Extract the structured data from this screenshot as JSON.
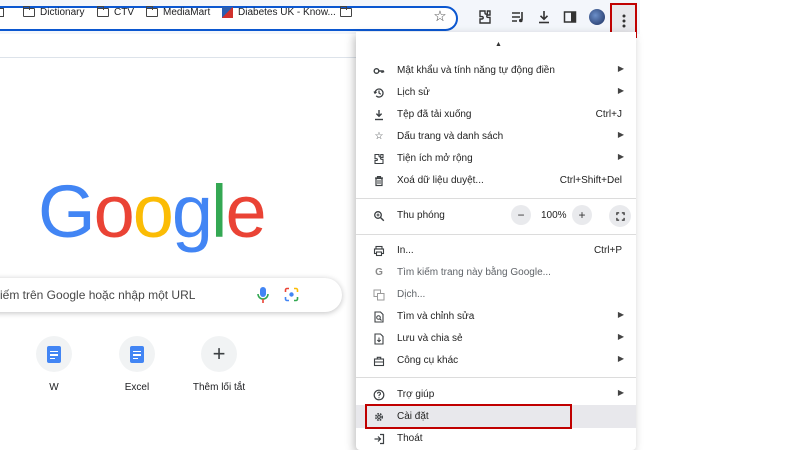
{
  "toolbar": {
    "icons": [
      "star-icon",
      "extensions-icon",
      "media-control-icon",
      "download-icon",
      "side-panel-icon",
      "avatar",
      "more-vert-icon"
    ]
  },
  "bookmarks": [
    {
      "label": "Dictionary",
      "icon": "folder-icon"
    },
    {
      "label": "CTV",
      "icon": "folder-icon"
    },
    {
      "label": "MediaMart",
      "icon": "folder-icon"
    },
    {
      "label": "Diabetes UK - Know...",
      "icon": "diabetes-uk-favicon"
    }
  ],
  "logo": {
    "letters": [
      "G",
      "o",
      "o",
      "g",
      "l",
      "e"
    ],
    "colors": [
      "#4285f4",
      "#ea4335",
      "#fbbc05",
      "#4285f4",
      "#34a853",
      "#ea4335"
    ]
  },
  "search": {
    "placeholder": "iếm trên Google hoặc nhập một URL"
  },
  "shortcuts": [
    {
      "label": "W",
      "icon": "docs-icon"
    },
    {
      "label": "Excel",
      "icon": "docs-icon"
    },
    {
      "label": "Thêm lối tắt",
      "icon": "plus-icon"
    }
  ],
  "menu": {
    "items": [
      {
        "label": "Mật khẩu và tính năng tự động điền",
        "icon": "key-icon",
        "shortcut": "",
        "submenu": true
      },
      {
        "label": "Lịch sử",
        "icon": "history-icon",
        "shortcut": "",
        "submenu": true
      },
      {
        "label": "Tệp đã tải xuống",
        "icon": "download-icon",
        "shortcut": "Ctrl+J",
        "submenu": false
      },
      {
        "label": "Dấu trang và danh sách",
        "icon": "star-icon",
        "shortcut": "",
        "submenu": true
      },
      {
        "label": "Tiện ích mở rộng",
        "icon": "extensions-icon",
        "shortcut": "",
        "submenu": true
      },
      {
        "label": "Xoá dữ liệu duyệt...",
        "icon": "trash-icon",
        "shortcut": "Ctrl+Shift+Del",
        "submenu": false
      }
    ],
    "zoom": {
      "label": "Thu phóng",
      "minus": "−",
      "value": "100%",
      "plus": "+"
    },
    "items2": [
      {
        "label": "In...",
        "icon": "print-icon",
        "shortcut": "Ctrl+P",
        "submenu": false
      },
      {
        "label": "Tìm kiếm trang này bằng Google...",
        "icon": "google-g-icon",
        "shortcut": "",
        "submenu": false
      },
      {
        "label": "Dịch...",
        "icon": "translate-icon",
        "shortcut": "",
        "submenu": false
      },
      {
        "label": "Tìm và chỉnh sửa",
        "icon": "find-icon",
        "shortcut": "",
        "submenu": true
      },
      {
        "label": "Lưu và chia sẻ",
        "icon": "save-icon",
        "shortcut": "",
        "submenu": true
      },
      {
        "label": "Công cụ khác",
        "icon": "toolbox-icon",
        "shortcut": "",
        "submenu": true
      }
    ],
    "items3": [
      {
        "label": "Trợ giúp",
        "icon": "help-icon",
        "shortcut": "",
        "submenu": true
      },
      {
        "label": "Cài đặt",
        "icon": "settings-icon",
        "shortcut": "",
        "submenu": false
      },
      {
        "label": "Thoát",
        "icon": "exit-icon",
        "shortcut": "",
        "submenu": false
      }
    ]
  },
  "highlight_color": "#c00000"
}
